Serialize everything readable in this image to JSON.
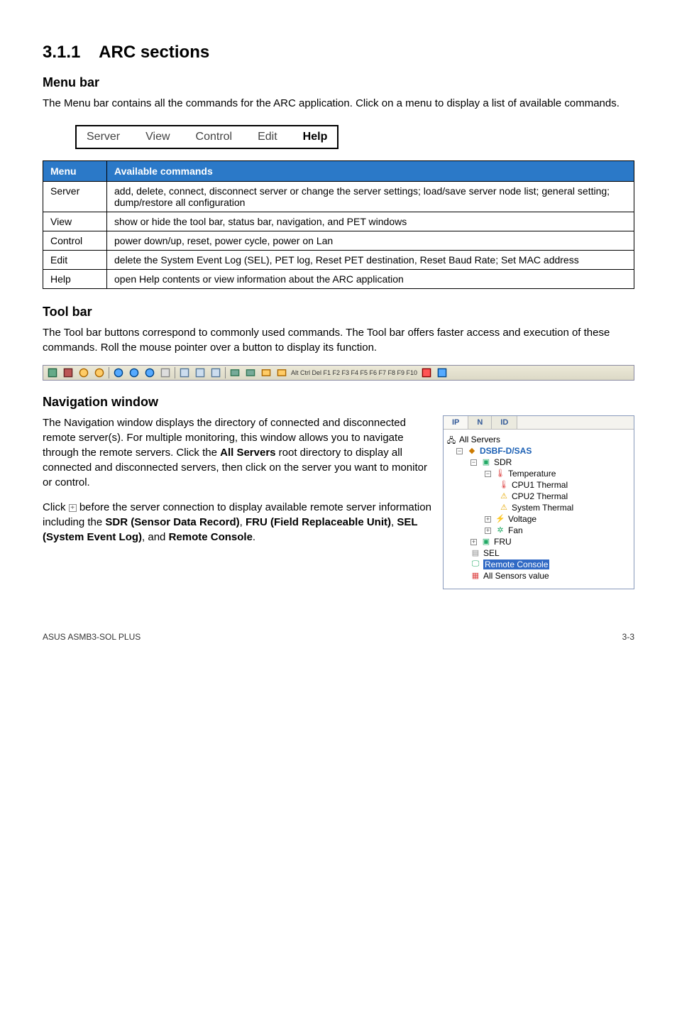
{
  "section": {
    "number": "3.1.1",
    "title": "ARC sections"
  },
  "menubar_section": {
    "heading": "Menu bar",
    "body": "The Menu bar contains all the commands for the ARC application. Click on a menu to display a list of available commands.",
    "items": [
      "Server",
      "View",
      "Control",
      "Edit",
      "Help"
    ]
  },
  "cmd_table": {
    "headers": [
      "Menu",
      "Available commands"
    ],
    "rows": [
      {
        "menu": "Server",
        "desc": "add, delete, connect, disconnect server or change the server settings; load/save server node list; general setting; dump/restore all configuration"
      },
      {
        "menu": "View",
        "desc": "show or hide the tool bar, status bar, navigation, and PET windows"
      },
      {
        "menu": "Control",
        "desc": "power down/up, reset, power cycle, power on Lan"
      },
      {
        "menu": "Edit",
        "desc": "delete the System Event Log (SEL), PET log, Reset PET destination, Reset Baud Rate; Set MAC address"
      },
      {
        "menu": "Help",
        "desc": "open Help contents or view information about the ARC application"
      }
    ]
  },
  "toolbar_section": {
    "heading": "Tool bar",
    "body": "The Tool bar buttons correspond to commonly used commands. The Tool bar offers faster access and execution of these commands. Roll the mouse pointer over a button to display its function.",
    "keys_text": "Alt Ctrl Del F1 F2 F3 F4 F5 F6 F7 F8 F9 F10"
  },
  "nav_section": {
    "heading": "Navigation window",
    "p1_a": "The Navigation window displays the directory of connected and disconnected remote server(s). For multiple monitoring, this window allows you to navigate through the remote servers. Click the ",
    "p1_bold": "All Servers",
    "p1_b": " root directory to display all connected and disconnected servers, then click on the server you want to monitor or control.",
    "p2_a": "Click ",
    "p2_b": " before the server connection to display available remote server information including the ",
    "p2_sdr": "SDR (Sensor Data Record)",
    "p2_c": ", ",
    "p2_fru": "FRU (Field Replaceable Unit)",
    "p2_d": ", ",
    "p2_sel": "SEL (System Event Log)",
    "p2_e": ", and ",
    "p2_rc": "Remote Console",
    "p2_f": "."
  },
  "tree": {
    "tabs": [
      "IP",
      "N",
      "ID"
    ],
    "nodes": {
      "all_servers": "All Servers",
      "server": "DSBF-D/SAS",
      "sdr": "SDR",
      "temperature": "Temperature",
      "cpu1_thermal": "CPU1 Thermal",
      "cpu2_thermal": "CPU2 Thermal",
      "system_thermal": "System Thermal",
      "voltage": "Voltage",
      "fan": "Fan",
      "fru": "FRU",
      "sel": "SEL",
      "remote_console": "Remote Console",
      "all_sensors": "All Sensors value"
    }
  },
  "footer": {
    "left": "ASUS ASMB3-SOL PLUS",
    "right": "3-3"
  }
}
